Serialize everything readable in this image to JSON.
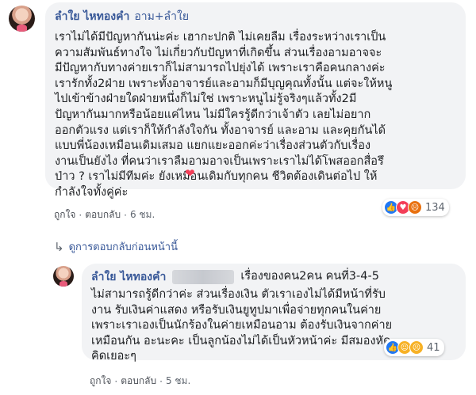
{
  "comment1": {
    "author": "ลำใย ไหทองคำ",
    "tag": "อาม+ลำใย",
    "text": "เราไม่ได้มีปัญหากันน่ะค่ะ เฮากะปกติ ไม่เคยลืม เรื่องระหว่างเราเป็น\nความสัมพันธ์ทางใจ ไม่เกี่ยวกับปัญหาที่เกิดขึ้น ส่วนเรื่องอามอาจจะ\nมีปัญหากับทางค่ายเราก็ไม่สามารถไปยุ่งได้ เพราะเราคือคนกลางค่ะ\nเรารักทั้ง2ฝ่าย เพราะทั้งอาจารย์และอามก็มีบุญคุณทั้งนั้น แต่จะให้หนู\nไปเข้าข้างฝ่ายใดฝ่ายหนึ่งก็ไม่ใช่ เพราะหนูไม่รู้จริงๆแล้วทั้ง2มี\nปัญหากันมากหรือน้อยแค่ไหน ไม่มีใครรู้ดีกว่าเจ้าตัว เลยไม่อยาก\nออกตัวแรง แต่เราก็ให้กำลังใจกัน ทั้งอาจารย์ และอาม และคุยกันได้\nแบบพี่น้องเหมือนเดิมเสมอ แยกแยะออกค่ะว่าเรื่องส่วนตัวกับเรื่อง\nงานเป็นยังไง ที่คนว่าเราลืมอามอาจเป็นเพราะเราไม่ได้โพสออกสื่อรึ\nป่าว ? เราไม่มีทีมค่ะ ยังเหมือนเดิมกับทุกคน ชีวิตต้องเดินต่อไป ให้\nกำลังใจทั้งคู่ค่ะ",
    "like_label": "ถูกใจ",
    "reply_label": "ตอบกลับ",
    "time": "6 ชม.",
    "reaction_count": "134"
  },
  "view_previous_replies": "ดูการตอบกลับก่อนหน้านี้",
  "comment2": {
    "author": "ลำใย ไหทองคำ",
    "text_first": "เรื่องของคน2คน คนที่3-4-5",
    "text": "ไม่สามารถรู้ดีกว่าค่ะ ส่วนเรื่องเงิน ตัวเราเองไม่ได้มีหน้าที่รับ\nงาน รับเงินค่าแสดง หรือรับเงินยูทูปมาเพื่อจ่ายทุกคนในค่าย\nเพราะเราเองเป็นนักร้องในค่ายเหมือนอาม ต้องรับเงินจากค่าย\nเหมือนกัน อะนะคะ เป็นลูกน้องไม่ได้เป็นหัวหน้าค่ะ มีสมองหัด\nคิดเยอะๆ",
    "like_label": "ถูกใจ",
    "reply_label": "ตอบกลับ",
    "time": "5 ชม.",
    "reaction_count": "41"
  },
  "colors": {
    "link": "#385898",
    "bubble": "#f2f3f5",
    "like": "#2078f4",
    "love": "#f33e58"
  }
}
